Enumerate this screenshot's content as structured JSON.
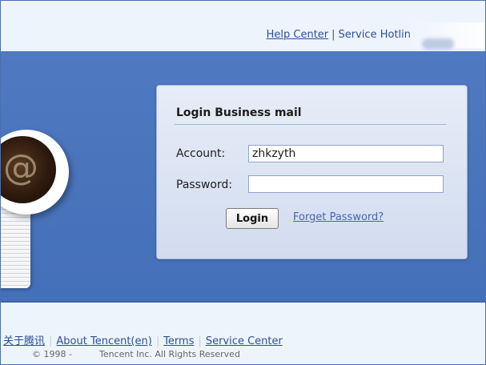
{
  "header": {
    "links": [
      {
        "label": "Help Center"
      },
      {
        "label": "Service Hotlin"
      }
    ],
    "separator": "|"
  },
  "hero": {
    "mug_icon": "at-sign-icon",
    "mug_glyph": "@",
    "colors": {
      "background": "#4a74bc",
      "card": "#dbe4f3"
    }
  },
  "login": {
    "title": "Login Business mail",
    "account_label": "Account:",
    "account_value": "zhkzyth",
    "password_label": "Password:",
    "password_value": "",
    "login_button": "Login",
    "forget_link": "Forget Password?"
  },
  "footer": {
    "links": [
      {
        "label": "关于腾讯"
      },
      {
        "label": "About Tencent(en)"
      },
      {
        "label": "Terms"
      },
      {
        "label": "Service Center"
      }
    ],
    "separator": "|",
    "copyright_start": "© 1998 -",
    "copyright_end": "Tencent Inc. All Rights Reserved"
  }
}
